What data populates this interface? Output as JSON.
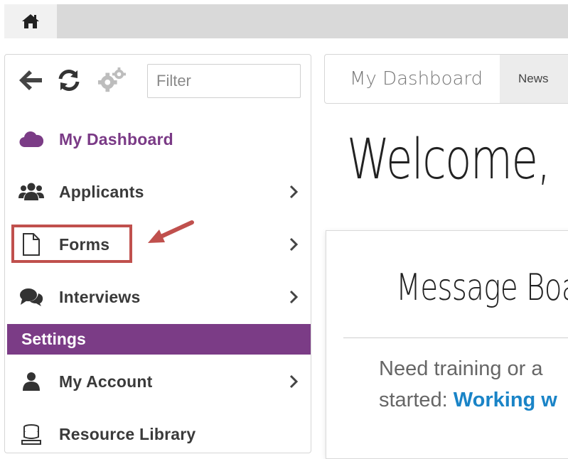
{
  "topbar": {
    "home_icon": "home-icon"
  },
  "toolbar": {
    "back_icon": "arrow-left-icon",
    "refresh_icon": "refresh-icon",
    "settings_icon": "gears-icon",
    "filter_placeholder": "Filter"
  },
  "sidebar": {
    "items": [
      {
        "label": "My Dashboard",
        "icon": "cloud-icon",
        "active": true
      },
      {
        "label": "Applicants",
        "icon": "users-icon"
      },
      {
        "label": "Forms",
        "icon": "file-icon"
      },
      {
        "label": "Interviews",
        "icon": "comments-icon"
      }
    ],
    "section_header": "Settings",
    "settings_items": [
      {
        "label": "My Account",
        "icon": "user-icon"
      },
      {
        "label": "Resource Library",
        "icon": "database-icon"
      }
    ]
  },
  "main": {
    "tabs": [
      {
        "label": "My Dashboard"
      },
      {
        "label": "News"
      }
    ],
    "welcome": "Welcome,",
    "message_board": {
      "title": "Message Boa",
      "line1": "Need training or a",
      "line2_prefix": "started: ",
      "line2_link": "Working w"
    }
  },
  "colors": {
    "accent": "#7b3c86",
    "highlight": "#c0504d",
    "link": "#1a84c7"
  }
}
